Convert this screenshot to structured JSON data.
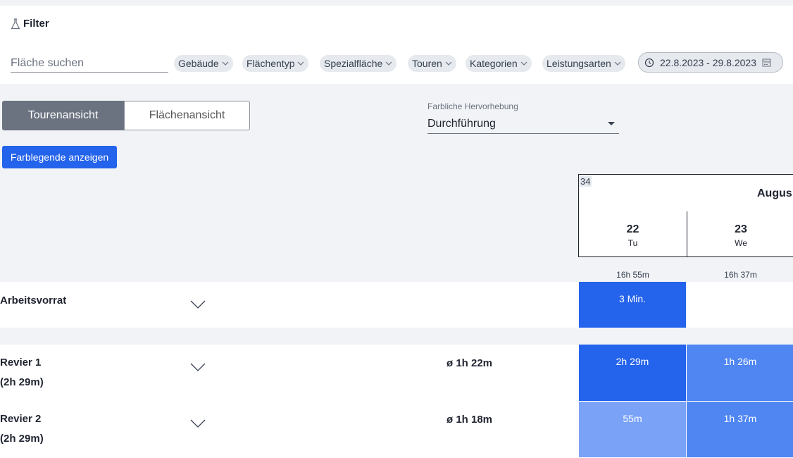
{
  "filter": {
    "title": "Filter",
    "search_placeholder": "Fläche suchen",
    "chips": [
      "Gebäude",
      "Flächentyp",
      "Spezialfläche",
      "Touren",
      "Kategorien",
      "Leistungsarten"
    ],
    "date_range": "22.8.2023 - 29.8.2023"
  },
  "view_toggle": {
    "active": "Tourenansicht",
    "inactive": "Flächenansicht"
  },
  "highlight": {
    "label": "Farbliche Hervorhebung",
    "value": "Durchführung"
  },
  "legend_button": "Farblegende anzeigen",
  "calendar": {
    "week": "34",
    "month": "Augus",
    "days": [
      {
        "num": "22",
        "weekday": "Tu",
        "total": "16h 55m"
      },
      {
        "num": "23",
        "weekday": "We",
        "total": "16h 37m"
      }
    ]
  },
  "rows": [
    {
      "name": "Arbeitsvorrat",
      "sub": "",
      "avg": "",
      "cells": [
        "3 Min.",
        ""
      ]
    },
    {
      "name": "Revier 1",
      "sub": "(2h 29m)",
      "avg": "ø 1h 22m",
      "cells": [
        "2h 29m",
        "1h 26m"
      ]
    },
    {
      "name": "Revier 2",
      "sub": "(2h 29m)",
      "avg": "ø 1h 18m",
      "cells": [
        "55m",
        "1h 37m"
      ]
    }
  ],
  "colors": {
    "primary": "#2463eb",
    "cell_strong": "#2463eb",
    "cell_medium": "#4f86f2",
    "cell_light": "#7aa2f7"
  }
}
